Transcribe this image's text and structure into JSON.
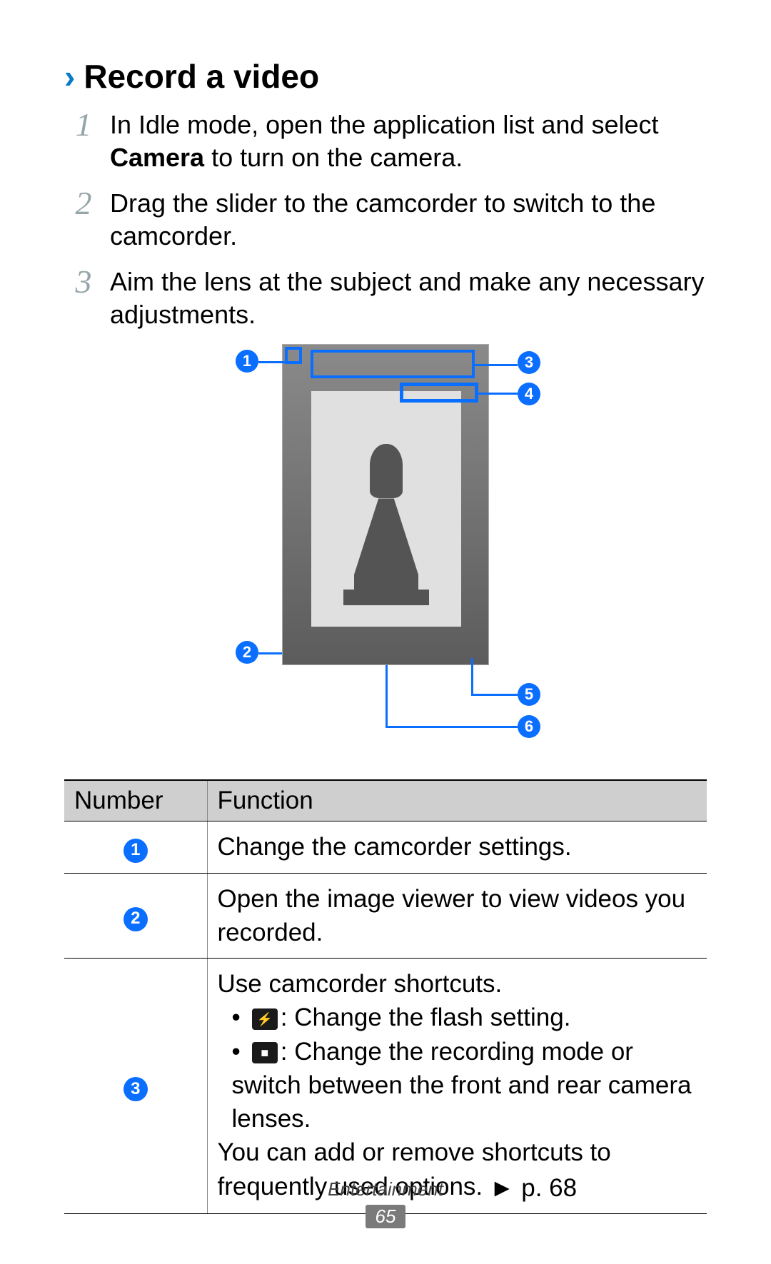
{
  "heading": "Record a video",
  "steps": [
    {
      "num": "1",
      "pre": "In Idle mode, open the application list and select ",
      "bold": "Camera",
      "post": " to turn on the camera."
    },
    {
      "num": "2",
      "pre": "Drag the slider to the camcorder to switch to the camcorder.",
      "bold": "",
      "post": ""
    },
    {
      "num": "3",
      "pre": "Aim the lens at the subject and make any necessary adjustments.",
      "bold": "",
      "post": ""
    }
  ],
  "callouts": {
    "c1": "1",
    "c2": "2",
    "c3": "3",
    "c4": "4",
    "c5": "5",
    "c6": "6"
  },
  "table": {
    "h_num": "Number",
    "h_fun": "Function",
    "rows": {
      "r1": {
        "n": "1",
        "f": "Change the camcorder settings."
      },
      "r2": {
        "n": "2",
        "f": "Open the image viewer to view videos you recorded."
      },
      "r3": {
        "n": "3",
        "intro": "Use camcorder shortcuts.",
        "b1": ": Change the flash setting.",
        "b2": ": Change the recording mode or switch between the front and rear camera lenses.",
        "outro_a": "You can add or remove shortcuts to frequently used options. ",
        "outro_ref": "► p. 68"
      }
    }
  },
  "footer": {
    "category": "Entertainment",
    "page": "65"
  }
}
